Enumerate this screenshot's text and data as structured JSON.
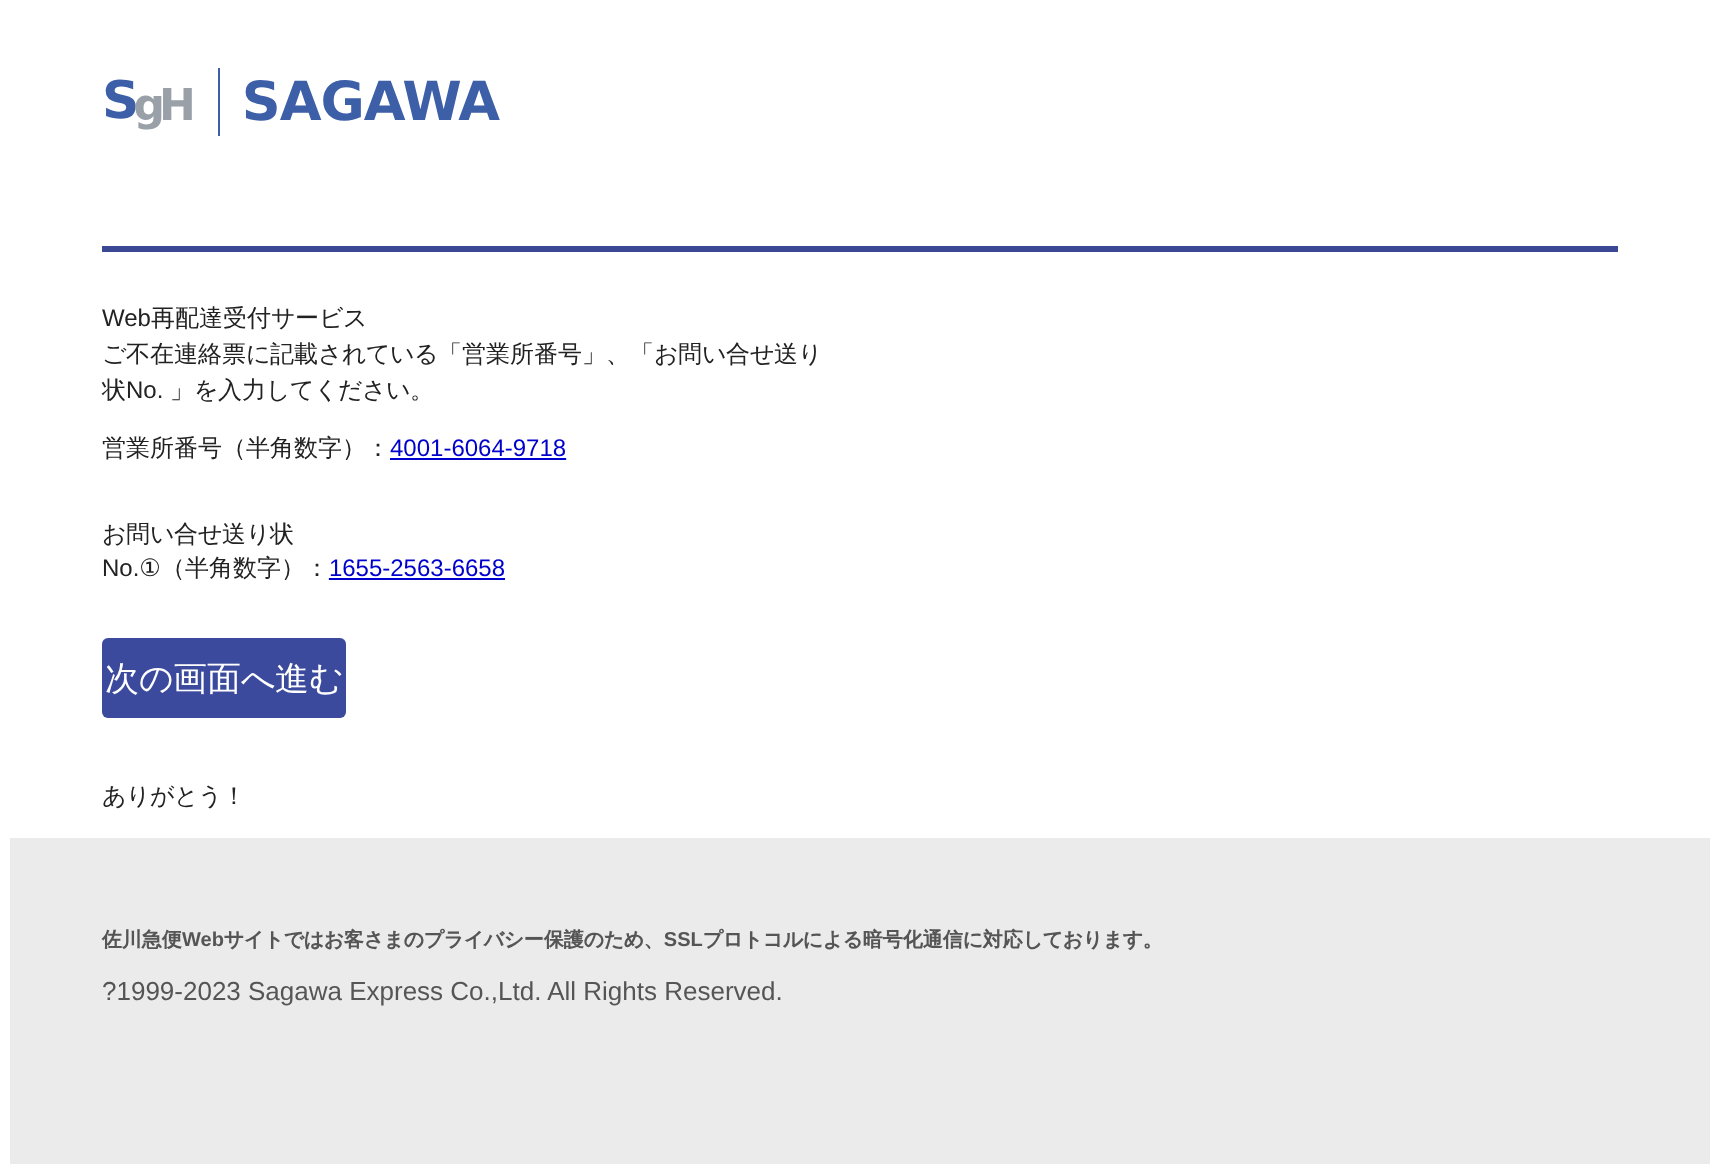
{
  "header": {
    "logo_mark": "SgH",
    "logo_text": "SAGAWA"
  },
  "body": {
    "service_title": "Web再配達受付サービス",
    "instruction": "ご不在連絡票に記載されている「営業所番号」、「お問い合せ送り状No. 」を入力してください。",
    "fields": [
      {
        "label": "営業所番号（半角数字）：",
        "value": "4001-6064-9718"
      },
      {
        "label": "お問い合せ送り状\nNo.①（半角数字）：",
        "value": "1655-2563-6658"
      }
    ],
    "button": "次の画面へ進む",
    "thanks": "ありがとう！"
  },
  "footer": {
    "notice": "佐川急便Webサイトではお客さまのプライバシー保護のため、SSLプロトコルによる暗号化通信に対応しております。",
    "copyright": "?1999-2023 Sagawa Express Co.,Ltd. All Rights Reserved."
  }
}
